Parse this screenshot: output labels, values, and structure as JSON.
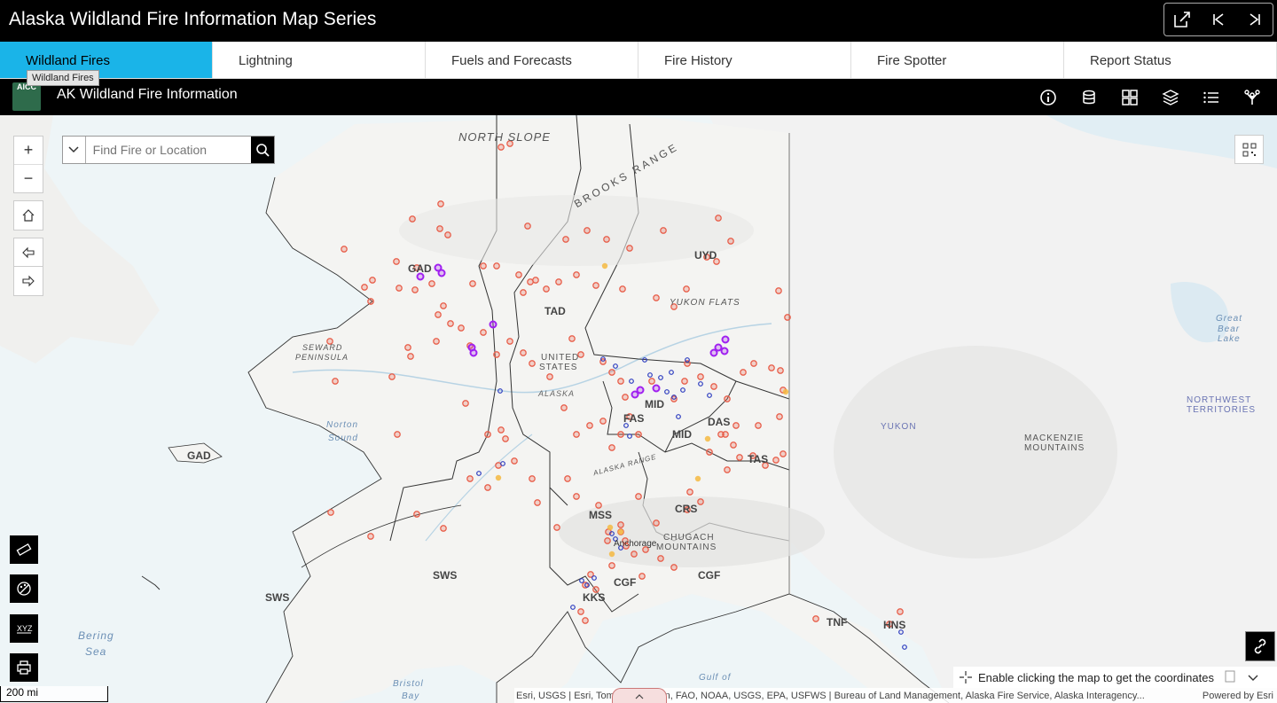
{
  "header": {
    "title": "Alaska Wildland Fire Information Map Series"
  },
  "header_controls": [
    "share-icon",
    "previous-icon",
    "next-icon"
  ],
  "tabs": [
    {
      "label": "Wildland Fires",
      "active": true
    },
    {
      "label": "Lightning"
    },
    {
      "label": "Fuels and Forecasts"
    },
    {
      "label": "Fire History"
    },
    {
      "label": "Fire Spotter"
    },
    {
      "label": "Report Status"
    }
  ],
  "tooltip": "Wildland Fires",
  "app": {
    "logo_text": "AICC",
    "title": "AK Wildland Fire Information",
    "tools": [
      "info-icon",
      "database-icon",
      "grid-icon",
      "layers-icon",
      "list-icon",
      "share-tree-icon"
    ]
  },
  "search": {
    "placeholder": "Find Fire or Location"
  },
  "map_labels": {
    "north_slope": "NORTH SLOPE",
    "brooks_range": "BROOKS RANGE",
    "yukon_flats": "YUKON FLATS",
    "seward": "SEWARD",
    "peninsula": "PENINSULA",
    "united": "UNITED",
    "states": "STATES",
    "alaska": "ALASKA",
    "norton": "Norton",
    "sound": "Sound",
    "alaska_range": "ALASKA RANGE",
    "chugach": "CHUGACH",
    "mountains": "MOUNTAINS",
    "anchorage": "Anchorage",
    "bering": "Bering",
    "sea": "Sea",
    "bristol": "Bristol",
    "bay": "Bay",
    "gulf_of": "Gulf of",
    "great": "Great",
    "bear": "Bear",
    "lake": "Lake",
    "northwest": "NORTHWEST",
    "territories": "TERRITORIES",
    "yukon": "YUKON",
    "mackenzie": "MACKENZIE",
    "mackenzie_mtns": "MOUNTAINS"
  },
  "zones": {
    "gad": "GAD",
    "gad2": "GAD",
    "tad": "TAD",
    "uyd": "UYD",
    "mid": "MID",
    "fas": "FAS",
    "mid2": "MID",
    "das": "DAS",
    "tas": "TAS",
    "mss": "MSS",
    "crs": "CRS",
    "sws": "SWS",
    "sws2": "SWS",
    "cgf": "CGF",
    "cgf2": "CGF",
    "kks": "KKS",
    "tnf": "TNF",
    "hns": "HNS"
  },
  "colors": {
    "fire": "#e8604c",
    "fire_recent": "#a020f0",
    "fire_new": "#f5b841",
    "lightning": "#2b3bbf",
    "accent": "#1ab4e8"
  },
  "scale": "200 mi",
  "coords_text": "Enable clicking the map to get the coordinates",
  "attribution": "Esri, USGS | Esri, TomTom, Garmin, FAO, NOAA, USGS, EPA, USFWS | Bureau of Land Management, Alaska Fire Service, Alaska Interagency...",
  "powered_by": "Powered by Esri"
}
